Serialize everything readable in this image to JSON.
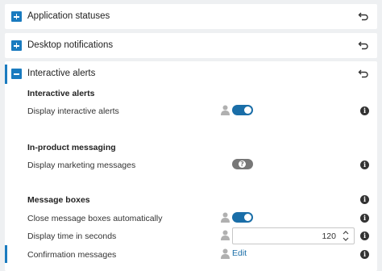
{
  "sections": [
    {
      "title": "Application statuses",
      "expanded": false
    },
    {
      "title": "Desktop notifications",
      "expanded": false
    },
    {
      "title": "Interactive alerts",
      "expanded": true
    }
  ],
  "interactive": {
    "group1": {
      "heading": "Interactive alerts",
      "rows": [
        {
          "label": "Display interactive alerts",
          "toggle": true
        }
      ]
    },
    "group2": {
      "heading": "In-product messaging",
      "rows": [
        {
          "label": "Display marketing messages",
          "toggle": "disabled"
        }
      ]
    },
    "group3": {
      "heading": "Message boxes",
      "rows": [
        {
          "label": "Close message boxes automatically",
          "toggle": true
        },
        {
          "label": "Display time in seconds",
          "value": "120"
        },
        {
          "label": "Confirmation messages",
          "link": "Edit"
        }
      ]
    }
  },
  "colors": {
    "accent": "#1a7bbf",
    "toggle_on": "#1a6ea8",
    "toggle_disabled": "#777777"
  },
  "icons": {
    "expand": "plus-square-icon",
    "collapse": "minus-square-icon",
    "reset": "undo-icon",
    "user": "person-icon",
    "info": "info-icon",
    "help": "question-icon"
  }
}
